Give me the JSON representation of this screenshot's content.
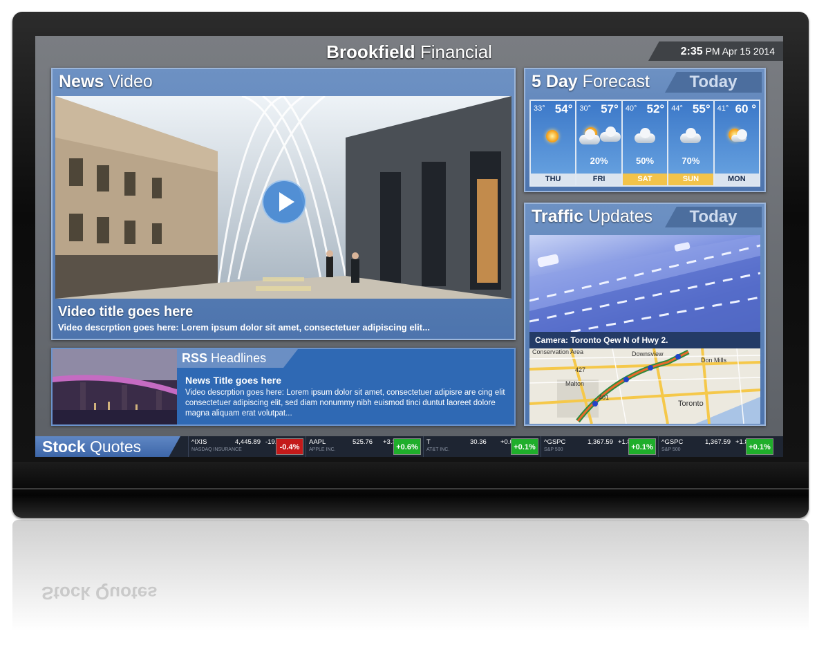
{
  "brand": {
    "bold": "Brookfield",
    "rest": "Financial"
  },
  "clock": {
    "time": "2:35",
    "ampm": "PM",
    "date": "Apr 15 2014"
  },
  "news": {
    "title_bold": "News",
    "title_rest": "Video",
    "video_title": "Video title goes here",
    "video_desc": "Video descrption goes here: Lorem ipsum dolor sit amet, consectetuer adipiscing elit..."
  },
  "rss": {
    "title_bold": "RSS",
    "title_rest": "Headlines",
    "headline": "News Title goes here",
    "body": "Video descrption goes here: Lorem ipsum dolor sit amet, consectetuer adipisre are cing elit consectetuer adipiscing elit, sed diam nonummy nibh euismod tinci duntut laoreet dolore magna aliquam erat volutpat..."
  },
  "forecast": {
    "title_bold": "5 Day",
    "title_rest": "Forecast",
    "today": "Today",
    "days": [
      {
        "name": "THU",
        "lo": "33°",
        "hi": "54°",
        "pct": "",
        "icon": "sun-icon"
      },
      {
        "name": "FRI",
        "lo": "30°",
        "hi": "57°",
        "pct": "20%",
        "icon": "partly-cloudy-icon"
      },
      {
        "name": "SAT",
        "lo": "40°",
        "hi": "52°",
        "pct": "50%",
        "icon": "cloud-icon"
      },
      {
        "name": "SUN",
        "lo": "44°",
        "hi": "55°",
        "pct": "70%",
        "icon": "cloud-icon"
      },
      {
        "name": "MON",
        "lo": "41°",
        "hi": "60 °",
        "pct": "",
        "icon": "partly-sunny-icon"
      }
    ]
  },
  "traffic": {
    "title_bold": "Traffic",
    "title_rest": "Updates",
    "today": "Today",
    "camera": "Camera: Toronto Qew N of Hwy 2.",
    "map_labels": [
      "Conservation Area",
      "Downsview",
      "Don Mills",
      "Malton",
      "Toronto",
      "427",
      "401"
    ]
  },
  "stocks": {
    "title_bold": "Stock",
    "title_rest": "Quotes",
    "quotes": [
      {
        "symbol": "^IXIS",
        "name": "NASDAQ INSURANCE",
        "price": "4,445.89",
        "change": "-19.43",
        "pct": "-0.4%",
        "dir": "down"
      },
      {
        "symbol": "AAPL",
        "name": "APPLE INC.",
        "price": "525.76",
        "change": "+3.35",
        "pct": "+0.6%",
        "dir": "up"
      },
      {
        "symbol": "T",
        "name": "AT&T INC.",
        "price": "30.36",
        "change": "+0.02",
        "pct": "+0.1%",
        "dir": "up"
      },
      {
        "symbol": "^GSPC",
        "name": "S&P 500",
        "price": "1,367.59",
        "change": "+1.85",
        "pct": "+0.1%",
        "dir": "up"
      },
      {
        "symbol": "^GSPC",
        "name": "S&P 500",
        "price": "1,367.59",
        "change": "+1.85",
        "pct": "+0.1%",
        "dir": "up"
      }
    ]
  },
  "colors": {
    "up": "#1fae2b",
    "down": "#c41a1a",
    "accent": "#4d74ad"
  }
}
